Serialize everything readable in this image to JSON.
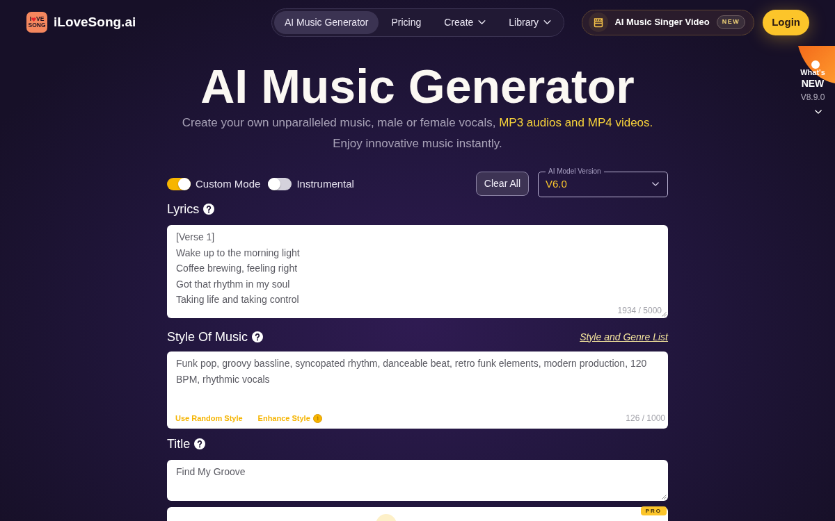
{
  "header": {
    "logo": {
      "line_1_start": "I",
      "line_1_end": "VE",
      "line_2": "SONG"
    },
    "brand": "iLoveSong.ai",
    "nav": [
      {
        "label": "AI Music Generator",
        "selected": true,
        "dropdown": false
      },
      {
        "label": "Pricing",
        "selected": false,
        "dropdown": false
      },
      {
        "label": "Create",
        "selected": false,
        "dropdown": true
      },
      {
        "label": "Library",
        "selected": false,
        "dropdown": true
      }
    ],
    "promo": {
      "label": "AI Music Singer Video",
      "badge": "NEW"
    },
    "login": "Login"
  },
  "whats_new": {
    "line_1": "What's",
    "line_2": "NEW",
    "version": "V8.9.0"
  },
  "hero": {
    "title": "AI Music Generator",
    "subtitle": "Create your own unparalleled music, male or female vocals,",
    "subtitle_highlight": "MP3 audios and MP4 videos.",
    "subtitle_line_2": "Enjoy innovative music instantly."
  },
  "controls": {
    "toggles": [
      {
        "label": "Custom Mode",
        "on": true
      },
      {
        "label": "Instrumental",
        "on": false
      }
    ],
    "clear_button": "Clear All",
    "model_select": {
      "label": "AI Model Version",
      "value": "V6.0"
    }
  },
  "lyrics": {
    "label": "Lyrics",
    "lines": [
      "[Verse 1]",
      "Wake up to the morning light",
      "Coffee brewing, feeling right",
      "Got that rhythm in my soul",
      "Taking life and taking control"
    ],
    "counter": "1934 / 5000"
  },
  "style": {
    "label": "Style Of Music",
    "link": "Style and Genre List",
    "value": "Funk pop, groovy bassline, syncopated rhythm, danceable beat, retro funk elements, modern production, 120 BPM, rhythmic vocals",
    "actions": [
      {
        "label": "Use Random Style",
        "kind": "plain"
      },
      {
        "label": "Enhance Style",
        "kind": "credit"
      }
    ],
    "counter": "126 / 1000"
  },
  "title_field": {
    "label": "Title",
    "value": "Find My Groove"
  },
  "next_card": {
    "badge": "PRO"
  }
}
